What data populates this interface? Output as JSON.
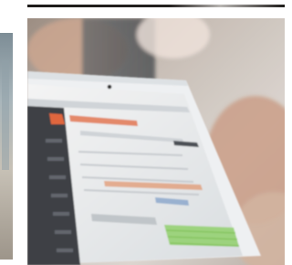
{
  "image": {
    "subject": "tablet-displaying-web-app",
    "colors": {
      "background": "#ffffff",
      "strip_dark": "#1e1c1a",
      "wall": "#cfc6bf",
      "tablet_frame": "#eef0f2",
      "app_accent": "#e0643a",
      "app_sidebar": "#3a3d42",
      "app_green": "#8fd06a"
    }
  }
}
